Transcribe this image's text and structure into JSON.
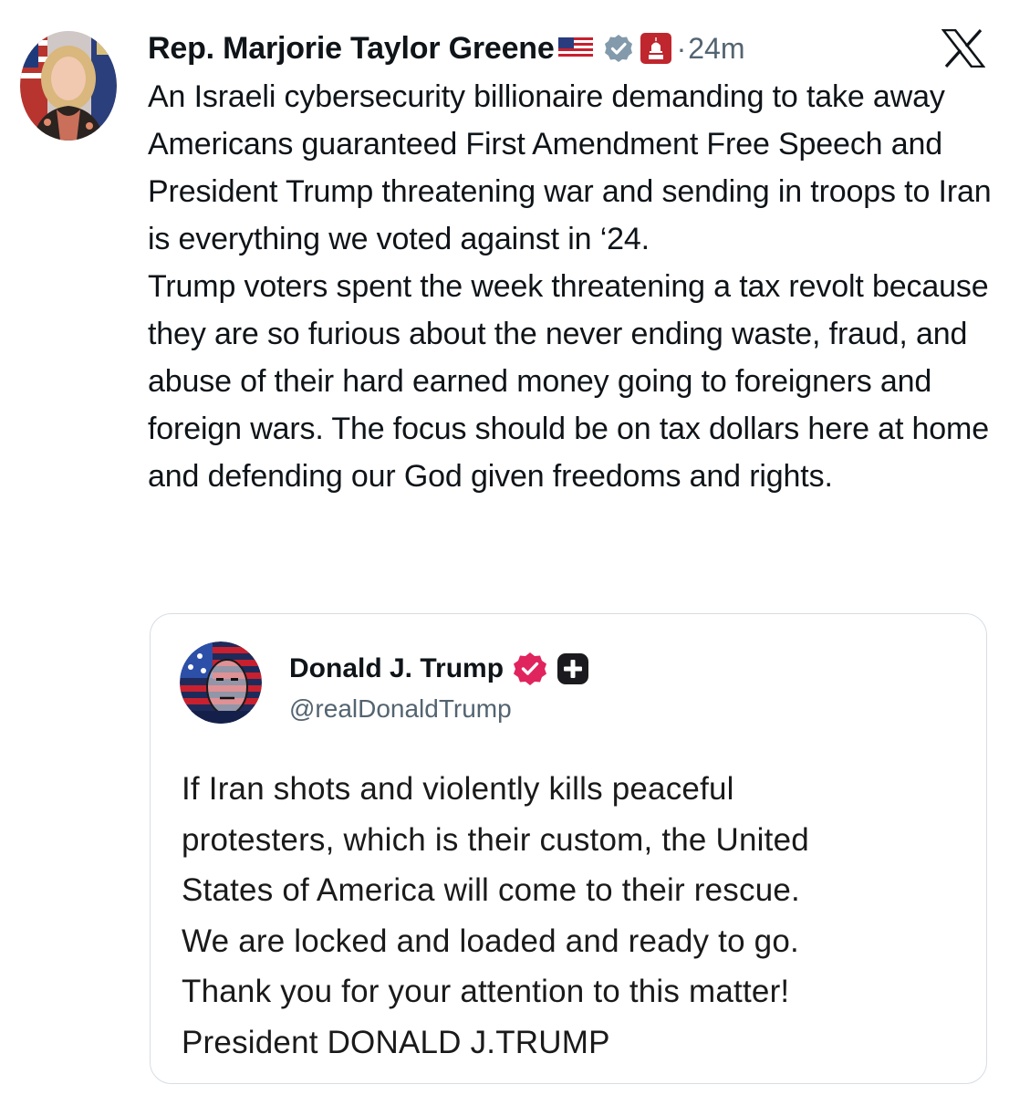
{
  "tweet": {
    "author_name": "Rep. Marjorie Taylor Greene",
    "author_emoji": "flag-us-icon",
    "verified_icon": "verified-gray-icon",
    "affiliation_icon": "house-gop-badge-icon",
    "separator": "·",
    "time": "24m",
    "platform_icon": "x-logo-icon",
    "paragraphs": [
      "An Israeli cybersecurity billionaire demanding to take away Americans guaranteed First Amendment Free Speech and President Trump threatening war and sending in troops to Iran is everything we voted against in ‘24.",
      "Trump voters spent the week threatening a tax revolt because they are so furious about the never ending waste, fraud, and abuse of their hard earned money going to foreigners and foreign wars. The focus should be on tax dollars here at home and defending our God given freedoms and rights."
    ]
  },
  "quote": {
    "author_name": "Donald J. Trump",
    "verified_icon": "verified-red-icon",
    "extra_icon": "plus-badge-icon",
    "handle": "@realDonaldTrump",
    "text": "If Iran shots and violently kills peaceful\nprotesters, which is their custom, the United\nStates of America will come to their rescue.\nWe are locked and loaded and ready to go.\nThank you for your attention to this matter!\nPresident DONALD J.TRUMP"
  },
  "colors": {
    "text": "#0f1419",
    "secondary": "#536471",
    "border": "#d7dde2",
    "verified_red": "#e0245e"
  }
}
